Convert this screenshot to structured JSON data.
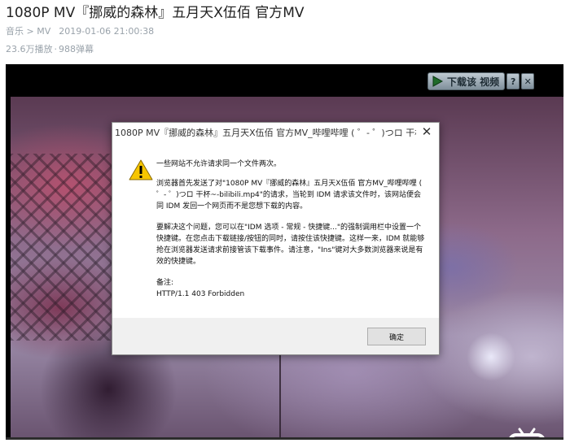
{
  "page": {
    "title": "1080P MV『挪威的森林』五月天X伍佰 官方MV",
    "category": "音乐 > MV",
    "date": "2019-01-06 21:00:38",
    "plays": "23.6万播放",
    "separator": "·",
    "danmaku": "988弹幕"
  },
  "player": {
    "download_button": "下载该 视频",
    "help_button": "?",
    "close_button": "✕"
  },
  "dialog": {
    "title": "1080P MV『挪威的森林』五月天X伍佰 官方MV_哔哩哔哩 ( ゜- ゜)つロ 干杯~-bili...",
    "close": "✕",
    "line1": "一些网站不允许请求同一个文件两次。",
    "para2": "浏览器首先发送了对\"1080P MV『挪威的森林』五月天X伍佰 官方MV_哔哩哔哩 ( ゜- ゜)つロ 干杯~-bilibili.mp4\"的请求，当轮到 IDM 请求该文件时，该网站便会同 IDM 发回一个网页而不是您想下载的内容。",
    "para3": "要解决这个问题，您可以在\"IDM 选项 - 常规 - 快捷键...\"的强制调用栏中设置一个快捷键。在您点击下载链接/按钮的同时，请按住该快捷键。这样一来，IDM 就能够抢在浏览器发送请求前接管该下载事件。请注意，\"Ins\"键对大多数浏览器来说是有效的快捷键。",
    "note_label": "备注:",
    "note_value": "HTTP/1.1 403 Forbidden",
    "ok_button": "确定"
  }
}
